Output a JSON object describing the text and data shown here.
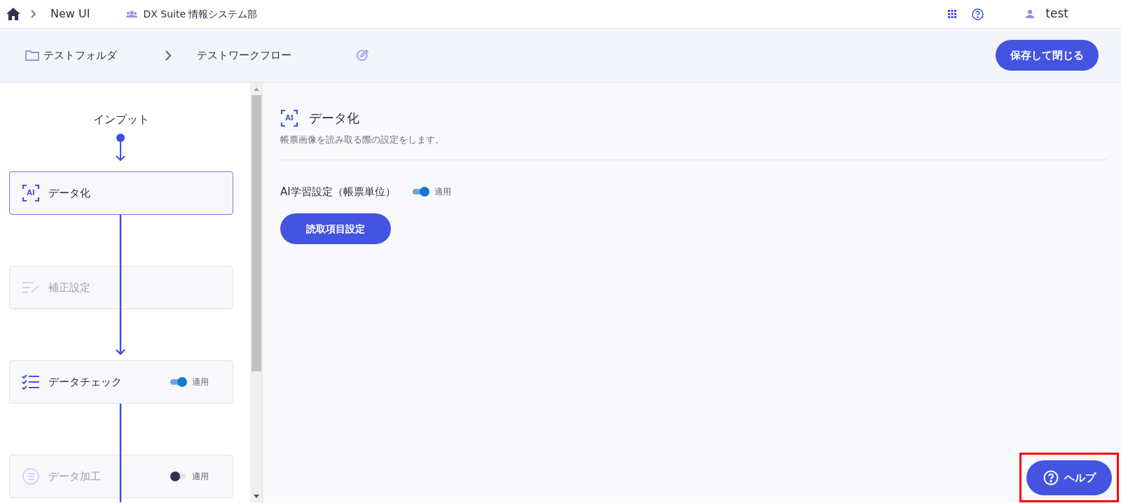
{
  "header": {
    "app": "New UI",
    "workspace": "DX Suite 情報システム部",
    "user": "test"
  },
  "breadcrumb": {
    "folder": "テストフォルダ",
    "workflow": "テストワークフロー",
    "save_button": "保存して閉じる"
  },
  "flow": {
    "start": "インプット",
    "nodes": [
      {
        "kind": "ai",
        "icon_text": "AI",
        "label": "データ化",
        "selected": true,
        "disabled": false
      },
      {
        "kind": "correct",
        "label": "補正設定",
        "selected": false,
        "disabled": true
      },
      {
        "kind": "check",
        "label": "データチェック",
        "selected": false,
        "disabled": false,
        "toggle": {
          "on": true,
          "label": "適用"
        }
      },
      {
        "kind": "process",
        "label": "データ加工",
        "selected": false,
        "disabled": true,
        "toggle": {
          "on": false,
          "label": "適用"
        }
      }
    ]
  },
  "detail": {
    "icon_text": "AI",
    "title": "データ化",
    "description": "帳票画像を読み取る際の設定をします。",
    "setting": {
      "label": "AI学習設定（帳票単位）",
      "on": true,
      "toggle_label": "適用"
    },
    "button": "読取項目設定"
  },
  "help_button": "ヘルプ"
}
